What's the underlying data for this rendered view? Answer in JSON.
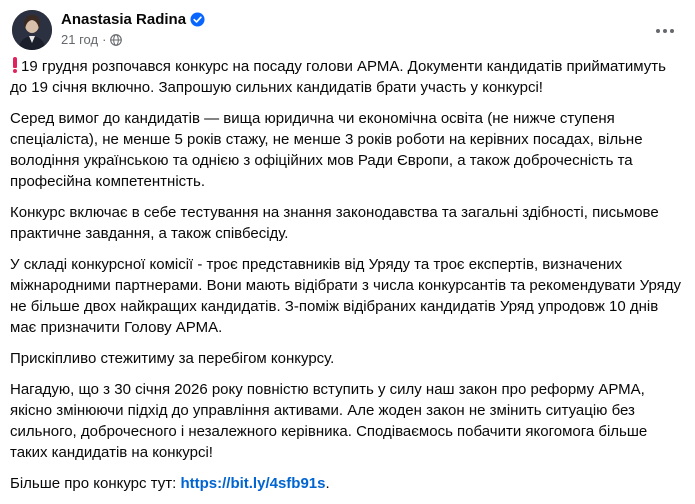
{
  "post": {
    "author": "Anastasia Radina",
    "time": "21 год",
    "meta_separator": "·",
    "paragraphs": [
      "19 грудня розпочався конкурс на посаду голови АРМА. Документи кандидатів прийматимуть до 19 січня включно. Запрошую сильних кандидатів брати участь у конкурсі!",
      "Серед вимог до кандидатів — вища юридична чи економічна освіта (не нижче ступеня спеціаліста), не менше 5 років стажу, не менше 3 років роботи на керівних посадах, вільне володіння українською та однією з офіційних мов Ради Європи, а також доброчесність та професійна компетентність.",
      "Конкурс включає в себе тестування на знання законодавства та загальні здібності, письмове практичне завдання, а також співбесіду.",
      "У складі конкурсної комісії - троє представників від Уряду та троє експертів, визначених міжнародними партнерами. Вони мають відібрати з числа конкурсантів та рекомендувати Уряду не більше двох найкращих кандидатів. З-поміж відібраних кандидатів Уряд упродовж 10 днів має призначити Голову АРМА.",
      "Прискіпливо стежитиму за перебігом конкурсу.",
      "Нагадую, що з 30 січня 2026 року повністю вступить у силу наш закон про реформу АРМА, якісно змінюючи підхід до управління активами. Але жоден закон не змінить ситуацію без сильного, доброчесного і незалежного керівника. Сподіваємось побачити якогомога більше таких кандидатів на конкурсі!"
    ],
    "more_label": "Більше про конкурс тут:",
    "link_text": "https://bit.ly/4sfb91s",
    "link_suffix": "."
  },
  "icons": {
    "verified": "verified-badge-icon",
    "audience": "globe-icon",
    "more": "more-horizontal-icon",
    "warning": "exclamation-emoji-icon"
  },
  "colors": {
    "text": "#080809",
    "secondary": "#65686c",
    "link": "#0064d1",
    "verified": "#0866ff",
    "warning": "#e0245e"
  }
}
